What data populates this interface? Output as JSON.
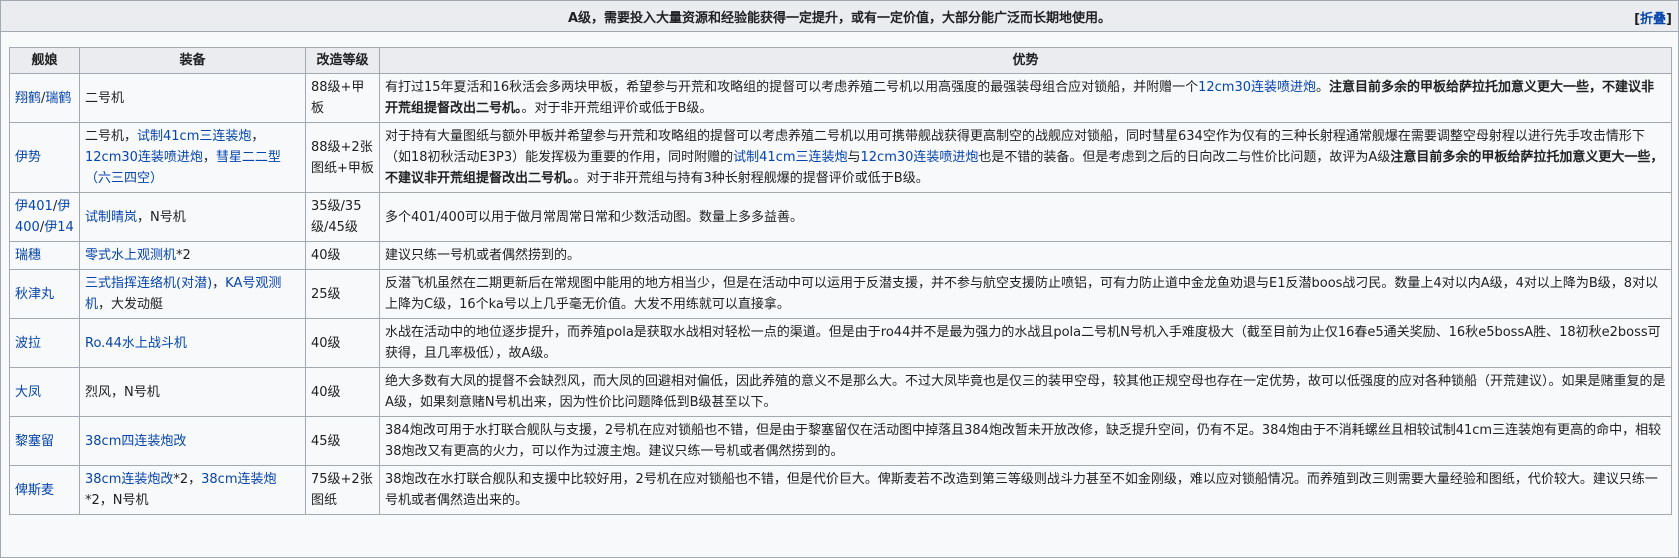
{
  "caption": {
    "title": "A级，需要投入大量资源和经验能获得一定提升，或有一定价值，大部分能广泛而长期地使用。",
    "toggle_open": "[",
    "toggle_label": "折叠",
    "toggle_close": "]"
  },
  "headers": [
    "舰娘",
    "装备",
    "改造等级",
    "优势"
  ],
  "rows": [
    {
      "ship": [
        {
          "t": "翔鹤",
          "link": true
        },
        {
          "t": "/"
        },
        {
          "t": "瑞鹤",
          "link": true
        }
      ],
      "equip": [
        {
          "t": "二号机"
        }
      ],
      "level": "88级+甲板",
      "adv": [
        {
          "t": "有打过15年夏活和16秋活会多两块甲板，希望参与开荒和攻略组的提督可以考虑养殖二号机以用高强度的最强装母组合应对锁船，并附赠一个"
        },
        {
          "t": "12cm30连装喷进炮",
          "link": true
        },
        {
          "t": "。"
        },
        {
          "t": "注意目前多余的甲板给萨拉托加意义更大一些，不建议非开荒组提督改出二号机。",
          "bold": true
        },
        {
          "t": "。对于非开荒组评价或低于B级。"
        }
      ]
    },
    {
      "ship": [
        {
          "t": "伊势",
          "link": true
        }
      ],
      "equip": [
        {
          "t": "二号机，"
        },
        {
          "t": "试制41cm三连装炮",
          "link": true
        },
        {
          "t": "，"
        },
        {
          "t": "12cm30连装喷进炮",
          "link": true
        },
        {
          "t": "，"
        },
        {
          "t": "彗星二二型（六三四空）",
          "link": true
        }
      ],
      "level": "88级+2张图纸+甲板",
      "adv": [
        {
          "t": "对于持有大量图纸与额外甲板并希望参与开荒和攻略组的提督可以考虑养殖二号机以用可携带舰战获得更高制空的战舰应对锁船，同时彗星634空作为仅有的三种长射程通常舰爆在需要调整空母射程以进行先手攻击情形下（如18初秋活动E3P3）能发挥极为重要的作用，同时附赠的"
        },
        {
          "t": "试制41cm三连装炮",
          "link": true
        },
        {
          "t": "与"
        },
        {
          "t": "12cm30连装喷进炮",
          "link": true
        },
        {
          "t": "也是不错的装备。但是考虑到之后的日向改二与性价比问题，故评为A级"
        },
        {
          "t": "注意目前多余的甲板给萨拉托加意义更大一些，不建议非开荒组提督改出二号机。",
          "bold": true
        },
        {
          "t": "。对于非开荒组与持有3种长射程舰爆的提督评价或低于B级。"
        }
      ]
    },
    {
      "ship": [
        {
          "t": "伊401",
          "link": true
        },
        {
          "t": "/"
        },
        {
          "t": "伊400",
          "link": true
        },
        {
          "t": "/"
        },
        {
          "t": "伊14",
          "link": true
        }
      ],
      "equip": [
        {
          "t": "试制晴岚",
          "link": true
        },
        {
          "t": "，N号机"
        }
      ],
      "level": "35级/35级/45级",
      "adv": [
        {
          "t": "多个401/400可以用于做月常周常日常和少数活动图。数量上多多益善。"
        }
      ]
    },
    {
      "ship": [
        {
          "t": "瑞穗",
          "link": true
        }
      ],
      "equip": [
        {
          "t": "零式水上观测机",
          "link": true
        },
        {
          "t": "*2"
        }
      ],
      "level": "40级",
      "adv": [
        {
          "t": "建议只练一号机或者偶然捞到的。"
        }
      ]
    },
    {
      "ship": [
        {
          "t": "秋津丸",
          "link": true
        }
      ],
      "equip": [
        {
          "t": "三式指挥连络机(对潜)",
          "link": true
        },
        {
          "t": "，"
        },
        {
          "t": "KA号观测机",
          "link": true
        },
        {
          "t": "，大发动艇"
        }
      ],
      "level": "25级",
      "adv": [
        {
          "t": "反潜飞机虽然在二期更新后在常规图中能用的地方相当少，但是在活动中可以运用于反潜支援，并不参与航空支援防止喷铝，可有力防止道中金龙鱼劝退与E1反潜boos战刁民。数量上4对以内A级，4对以上降为B级，8对以上降为C级，16个ka号以上几乎毫无价值。大发不用练就可以直接拿。"
        }
      ]
    },
    {
      "ship": [
        {
          "t": "波拉",
          "link": true
        }
      ],
      "equip": [
        {
          "t": "Ro.44水上战斗机",
          "link": true
        }
      ],
      "level": "40级",
      "adv": [
        {
          "t": "水战在活动中的地位逐步提升，而养殖pola是获取水战相对轻松一点的渠道。但是由于ro44并不是最为强力的水战且pola二号机N号机入手难度极大（截至目前为止仅16春e5通关奖励、16秋e5bossA胜、18初秋e2boss可获得，且几率极低），故A级。"
        }
      ]
    },
    {
      "ship": [
        {
          "t": "大凤",
          "link": true
        }
      ],
      "equip": [
        {
          "t": "烈风，N号机"
        }
      ],
      "level": "40级",
      "adv": [
        {
          "t": "绝大多数有大凤的提督不会缺烈风，而大凤的回避相对偏低，因此养殖的意义不是那么大。不过大凤毕竟也是仅三的装甲空母，较其他正规空母也存在一定优势，故可以低强度的应对各种锁船（开荒建议）。如果是赌重复的是A级，如果刻意赌N号机出来，因为性价比问题降低到B级甚至以下。"
        }
      ]
    },
    {
      "ship": [
        {
          "t": "黎塞留",
          "link": true
        }
      ],
      "equip": [
        {
          "t": "38cm四连装炮改",
          "link": true
        }
      ],
      "level": "45级",
      "adv": [
        {
          "t": "384炮改可用于水打联合舰队与支援，2号机在应对锁船也不错，但是由于黎塞留仅在活动图中掉落且384炮改暂未开放改修，缺乏提升空间，仍有不足。384炮由于不消耗螺丝且相较试制41cm三连装炮有更高的命中，相较38炮改又有更高的火力，可以作为过渡主炮。建议只练一号机或者偶然捞到的。"
        }
      ]
    },
    {
      "ship": [
        {
          "t": "俾斯麦",
          "link": true
        }
      ],
      "equip": [
        {
          "t": "38cm连装炮改",
          "link": true
        },
        {
          "t": "*2，"
        },
        {
          "t": "38cm连装炮",
          "link": true
        },
        {
          "t": "*2，N号机"
        }
      ],
      "level": "75级+2张图纸",
      "adv": [
        {
          "t": "38炮改在水打联合舰队和支援中比较好用，2号机在应对锁船也不错，但是代价巨大。俾斯麦若不改造到第三等级则战斗力甚至不如金刚级，难以应对锁船情况。而养殖到改三则需要大量经验和图纸，代价较大。建议只练一号机或者偶然造出来的。"
        }
      ]
    }
  ]
}
